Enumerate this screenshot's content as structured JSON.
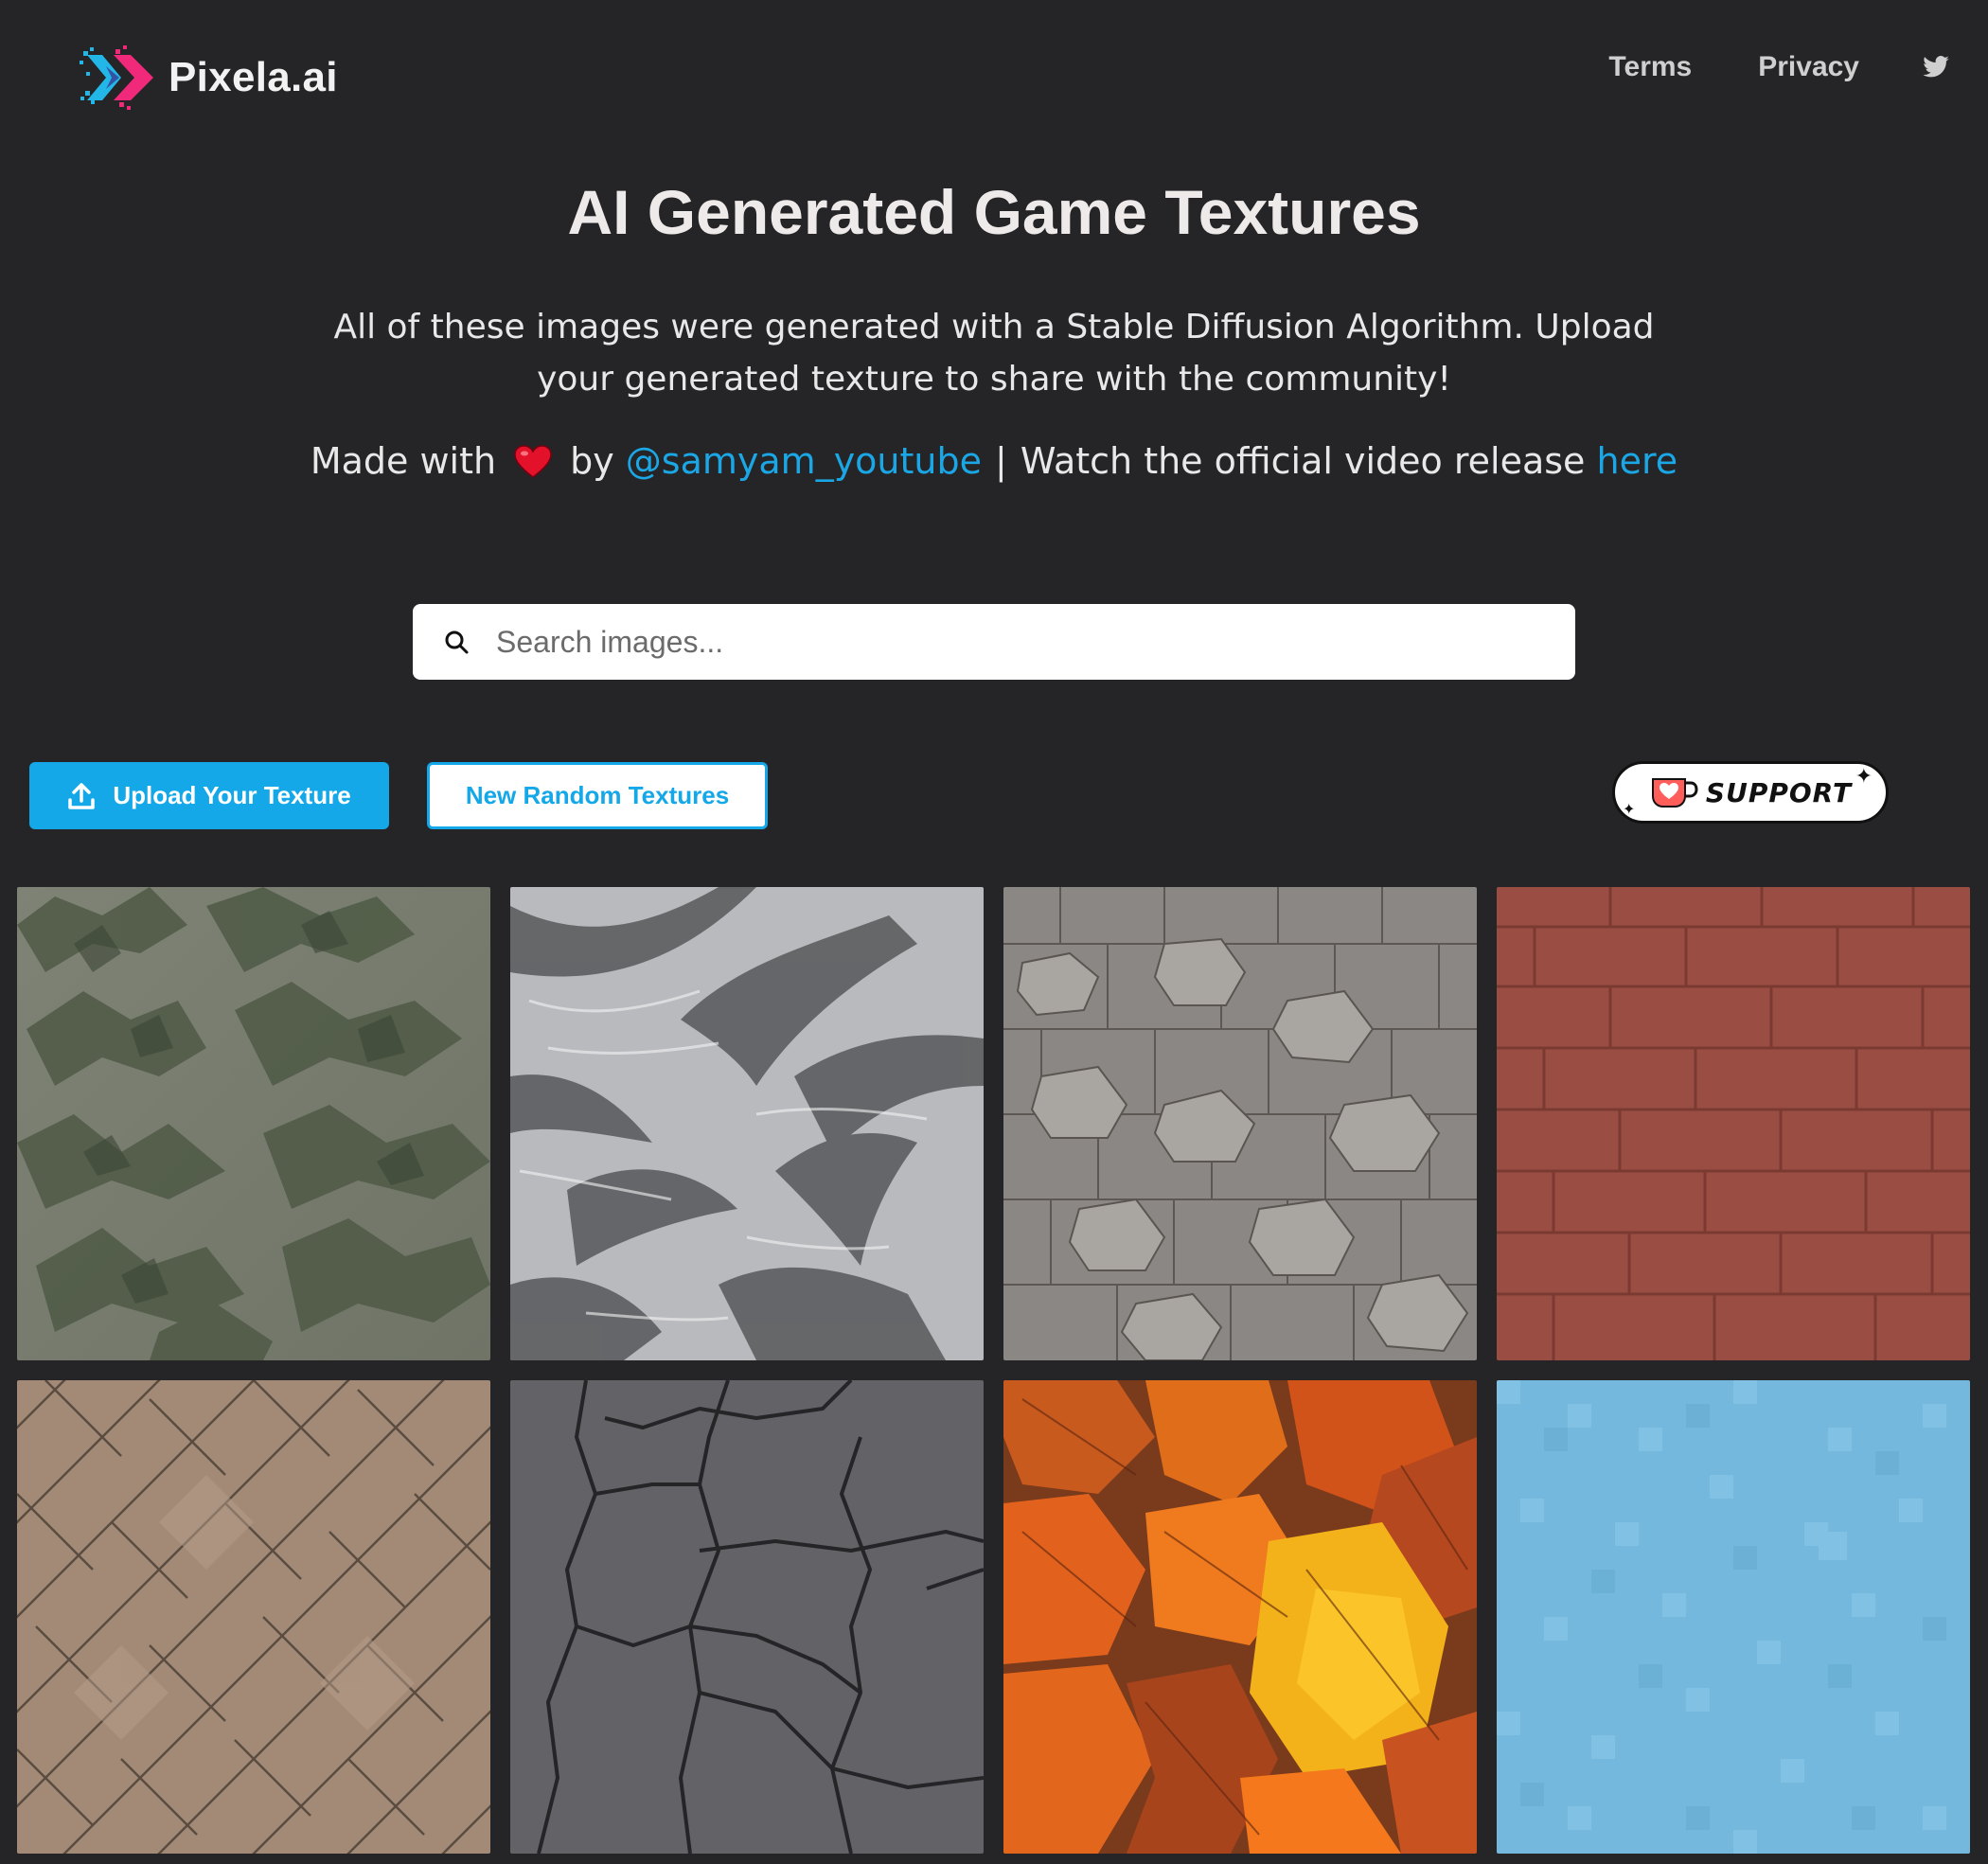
{
  "header": {
    "brand": "Pixela.ai",
    "nav": {
      "terms": "Terms",
      "privacy": "Privacy"
    }
  },
  "hero": {
    "title": "AI Generated Game Textures",
    "description": "All of these images were generated with a Stable Diffusion Algorithm. Upload your generated texture to share with the community!",
    "made_with_prefix": "Made with",
    "by": "by",
    "author_link": "@samyam_youtube",
    "separator": "|",
    "video_text": "Watch the official video release",
    "video_link": "here"
  },
  "search": {
    "placeholder": "Search images..."
  },
  "actions": {
    "upload_label": "Upload Your Texture",
    "random_label": "New Random Textures",
    "support_label": "SUPPORT"
  },
  "textures": [
    {
      "name": "mountain-terrain"
    },
    {
      "name": "grey-fur-waves"
    },
    {
      "name": "stone-cobble-wall"
    },
    {
      "name": "red-brick-wall"
    },
    {
      "name": "tan-diagonal-tiles"
    },
    {
      "name": "cracked-dark-stone"
    },
    {
      "name": "autumn-leaves"
    },
    {
      "name": "blue-pixel-tiles"
    }
  ],
  "colors": {
    "background": "#252527",
    "accent": "#14a8e8",
    "logo_pink": "#f0297a",
    "logo_cyan": "#23b7e8"
  }
}
